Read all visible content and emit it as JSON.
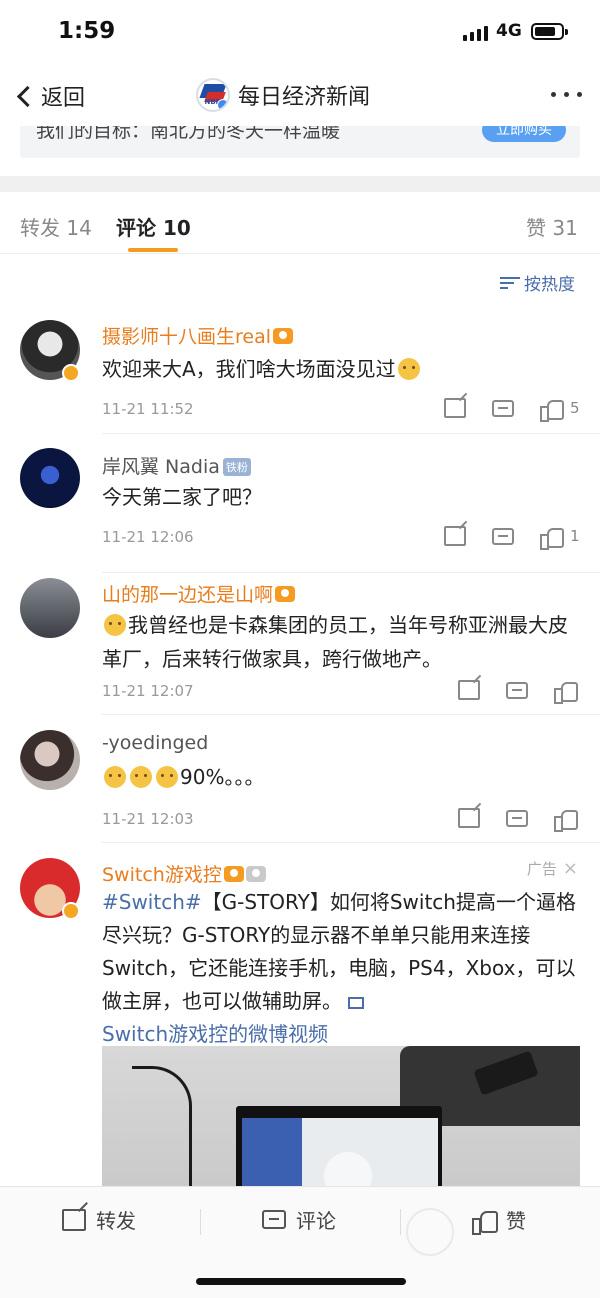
{
  "status": {
    "time": "1:59",
    "network": "4G",
    "battery_level": 0.8
  },
  "nav": {
    "back_label": "返回",
    "title": "每日经济新闻",
    "logo_text": "NBD"
  },
  "clipped_card": {
    "text": "我们的目标：南北方的冬天一样温暖",
    "button": "立即购买"
  },
  "tabs": [
    {
      "label": "转发 14",
      "active": false
    },
    {
      "label": "评论 10",
      "active": true
    },
    {
      "label": "赞 31",
      "active": false
    }
  ],
  "sort_label": "按热度",
  "comments": [
    {
      "user": "摄影师十八画生real",
      "text": "欢迎来大A，我们啥大场面没见过",
      "time": "11-21 11:52",
      "likes": "5"
    },
    {
      "user": "岸风翼 Nadia",
      "badge": "铁粉",
      "text": "今天第二家了吧？",
      "time": "11-21 12:06",
      "likes": "1"
    },
    {
      "user": "山的那一边还是山啊",
      "text": "我曾经也是卡森集团的员工，当年号称亚洲最大皮革厂，后来转行做家具，跨行做地产。",
      "time": "11-21 12:07",
      "likes": ""
    },
    {
      "user": "-yoedinged",
      "text": "90%。。。",
      "time": "11-21 12:03",
      "likes": ""
    }
  ],
  "ad_post": {
    "user": "Switch游戏控",
    "ad_label": "广告",
    "close": "×",
    "hashtag": "#Switch#",
    "text": "【G-STORY】如何将Switch提高一个逼格尽兴玩？G-STORY的显示器不单单只能用来连接Switch，它还能连接手机，电脑，PS4，Xbox，可以做主屏，也可以做辅助屏。",
    "video_link": "Switch游戏控的微博视频"
  },
  "bottom_bar": {
    "share": "转发",
    "comment": "评论",
    "like": "赞"
  }
}
